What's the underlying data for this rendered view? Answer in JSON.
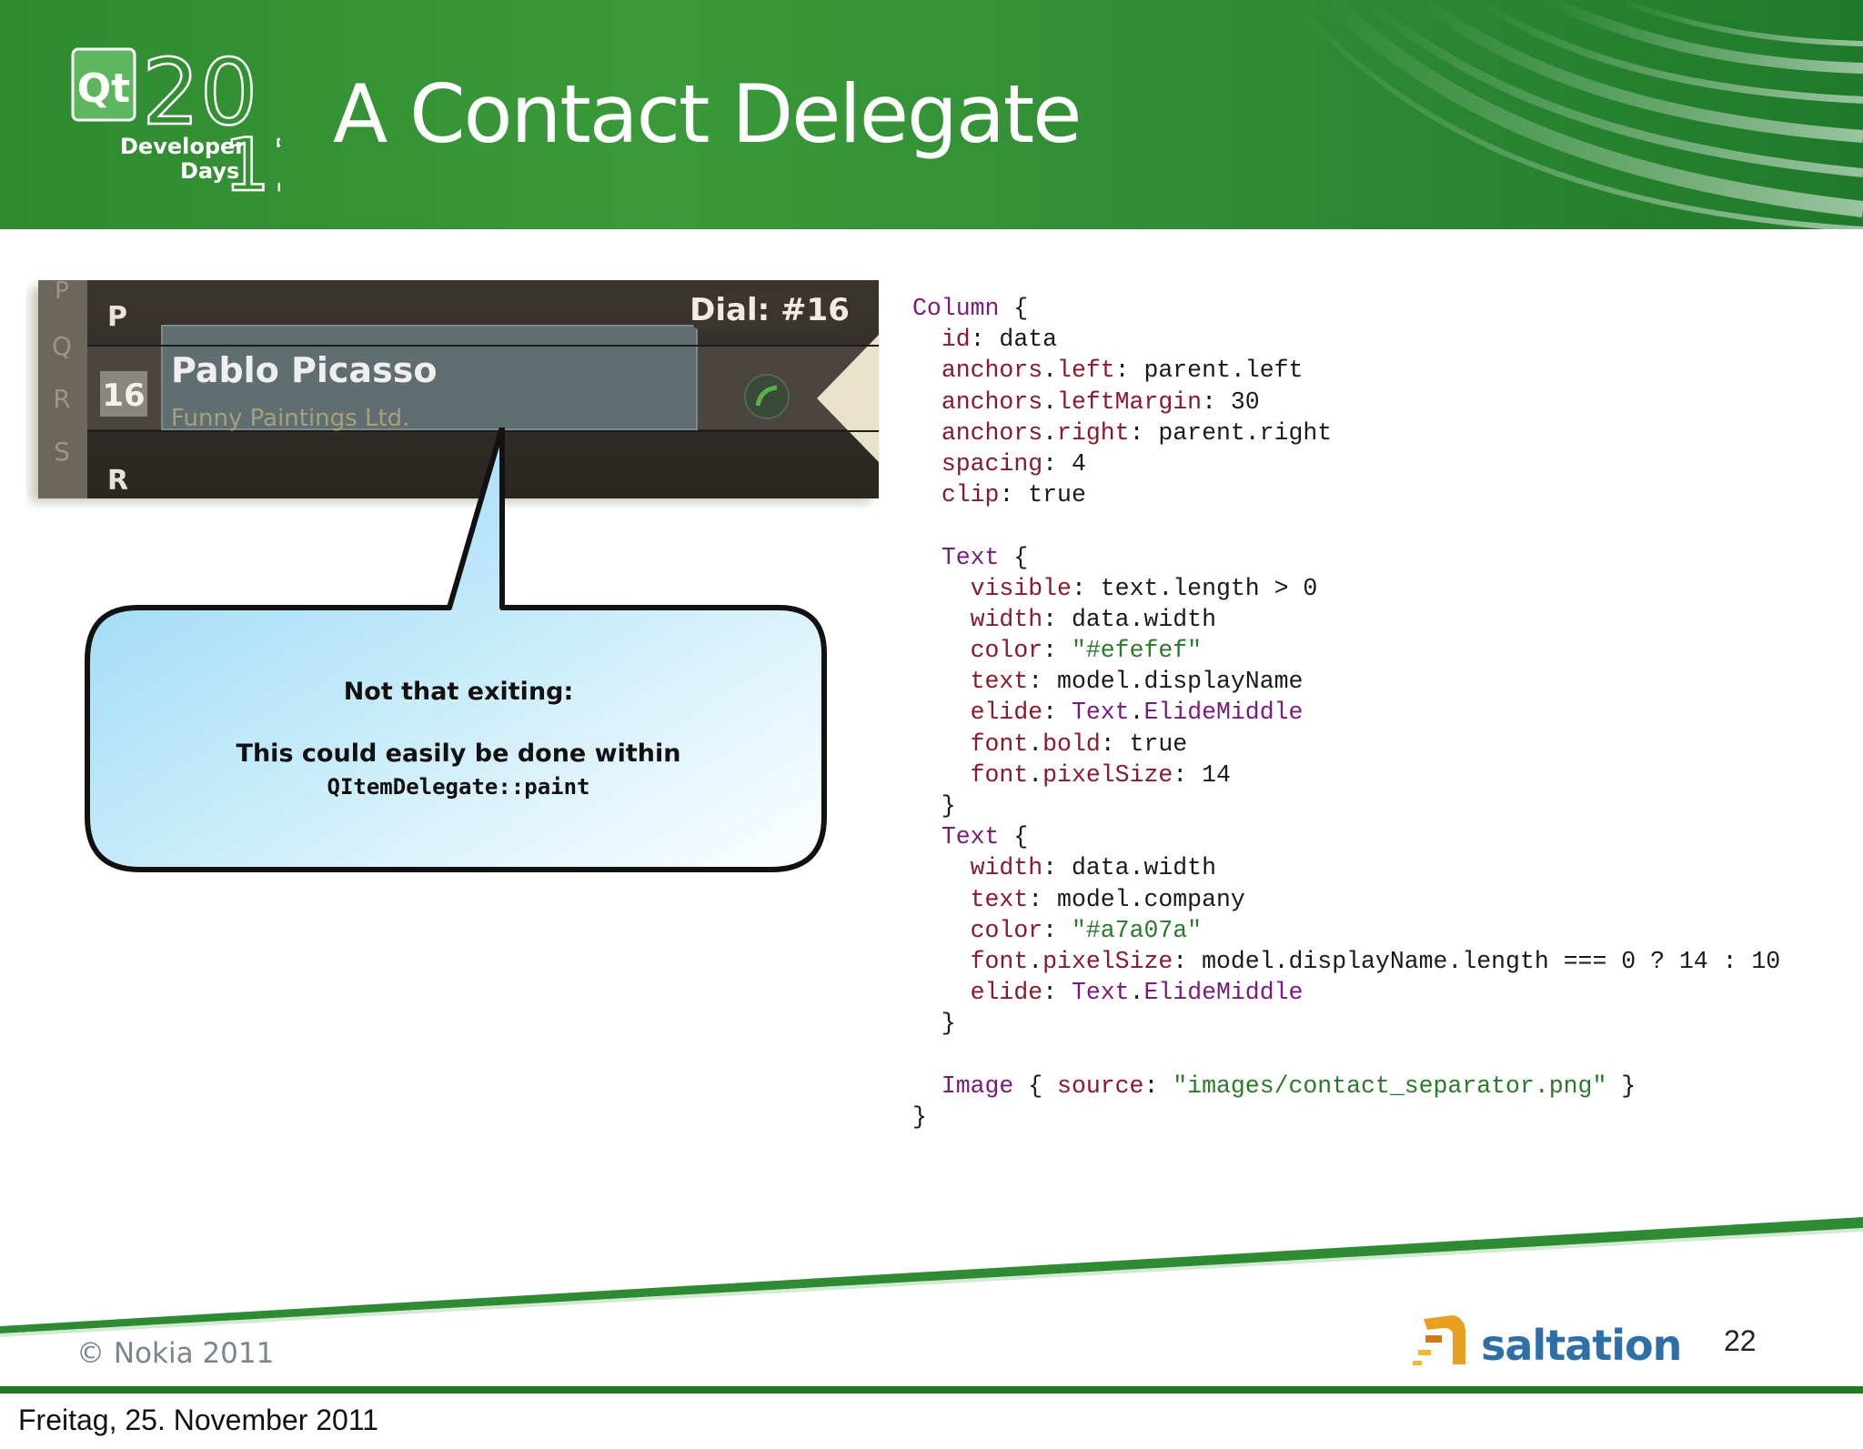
{
  "slide": {
    "title": "A Contact Delegate",
    "page_number": "22",
    "copyright": "© Nokia 2011",
    "brand": "saltation",
    "logo": {
      "qt": "Qt",
      "year_top": "20",
      "year_bottom": "11",
      "line1": "Developer",
      "line2": "Days"
    }
  },
  "screenshot": {
    "index_letters": [
      "P",
      "Q",
      "R",
      "S"
    ],
    "section_top": "P",
    "section_bottom": "R",
    "badge": "16",
    "dial_label": "Dial: #16",
    "contact_name": "Pablo Picasso",
    "contact_company": "Funny Paintings Ltd."
  },
  "callout": {
    "line1": "Not that exiting:",
    "line2": "This could easily be done within",
    "line3": "QItemDelegate::paint"
  },
  "code_lines": [
    [
      {
        "t": "Column",
        "c": "kw"
      },
      {
        "t": " {",
        "c": ""
      }
    ],
    [
      {
        "t": "  ",
        "c": ""
      },
      {
        "t": "id",
        "c": "pr"
      },
      {
        "t": ": data",
        "c": ""
      }
    ],
    [
      {
        "t": "  ",
        "c": ""
      },
      {
        "t": "anchors",
        "c": "pr"
      },
      {
        "t": ".",
        "c": ""
      },
      {
        "t": "left",
        "c": "pr"
      },
      {
        "t": ": parent.left",
        "c": ""
      }
    ],
    [
      {
        "t": "  ",
        "c": ""
      },
      {
        "t": "anchors",
        "c": "pr"
      },
      {
        "t": ".",
        "c": ""
      },
      {
        "t": "leftMargin",
        "c": "pr"
      },
      {
        "t": ": 30",
        "c": ""
      }
    ],
    [
      {
        "t": "  ",
        "c": ""
      },
      {
        "t": "anchors",
        "c": "pr"
      },
      {
        "t": ".",
        "c": ""
      },
      {
        "t": "right",
        "c": "pr"
      },
      {
        "t": ": parent.right",
        "c": ""
      }
    ],
    [
      {
        "t": "  ",
        "c": ""
      },
      {
        "t": "spacing",
        "c": "pr"
      },
      {
        "t": ": 4",
        "c": ""
      }
    ],
    [
      {
        "t": "  ",
        "c": ""
      },
      {
        "t": "clip",
        "c": "pr"
      },
      {
        "t": ": true",
        "c": ""
      }
    ],
    [
      {
        "t": "",
        "c": ""
      }
    ],
    [
      {
        "t": "  ",
        "c": ""
      },
      {
        "t": "Text",
        "c": "kw"
      },
      {
        "t": " {",
        "c": ""
      }
    ],
    [
      {
        "t": "    ",
        "c": ""
      },
      {
        "t": "visible",
        "c": "pr"
      },
      {
        "t": ": text.length > 0",
        "c": ""
      }
    ],
    [
      {
        "t": "    ",
        "c": ""
      },
      {
        "t": "width",
        "c": "pr"
      },
      {
        "t": ": data.width",
        "c": ""
      }
    ],
    [
      {
        "t": "    ",
        "c": ""
      },
      {
        "t": "color",
        "c": "pr"
      },
      {
        "t": ": ",
        "c": ""
      },
      {
        "t": "\"#efefef\"",
        "c": "st"
      }
    ],
    [
      {
        "t": "    ",
        "c": ""
      },
      {
        "t": "text",
        "c": "pr"
      },
      {
        "t": ": model.displayName",
        "c": ""
      }
    ],
    [
      {
        "t": "    ",
        "c": ""
      },
      {
        "t": "elide",
        "c": "pr"
      },
      {
        "t": ": ",
        "c": ""
      },
      {
        "t": "Text",
        "c": "cl"
      },
      {
        "t": ".",
        "c": ""
      },
      {
        "t": "ElideMiddle",
        "c": "cl"
      }
    ],
    [
      {
        "t": "    ",
        "c": ""
      },
      {
        "t": "font",
        "c": "pr"
      },
      {
        "t": ".",
        "c": ""
      },
      {
        "t": "bold",
        "c": "pr"
      },
      {
        "t": ": true",
        "c": ""
      }
    ],
    [
      {
        "t": "    ",
        "c": ""
      },
      {
        "t": "font",
        "c": "pr"
      },
      {
        "t": ".",
        "c": ""
      },
      {
        "t": "pixelSize",
        "c": "pr"
      },
      {
        "t": ": 14",
        "c": ""
      }
    ],
    [
      {
        "t": "  }",
        "c": ""
      }
    ],
    [
      {
        "t": "  ",
        "c": ""
      },
      {
        "t": "Text",
        "c": "kw"
      },
      {
        "t": " {",
        "c": ""
      }
    ],
    [
      {
        "t": "    ",
        "c": ""
      },
      {
        "t": "width",
        "c": "pr"
      },
      {
        "t": ": data.width",
        "c": ""
      }
    ],
    [
      {
        "t": "    ",
        "c": ""
      },
      {
        "t": "text",
        "c": "pr"
      },
      {
        "t": ": model.company",
        "c": ""
      }
    ],
    [
      {
        "t": "    ",
        "c": ""
      },
      {
        "t": "color",
        "c": "pr"
      },
      {
        "t": ": ",
        "c": ""
      },
      {
        "t": "\"#a7a07a\"",
        "c": "st"
      }
    ],
    [
      {
        "t": "    ",
        "c": ""
      },
      {
        "t": "font",
        "c": "pr"
      },
      {
        "t": ".",
        "c": ""
      },
      {
        "t": "pixelSize",
        "c": "pr"
      },
      {
        "t": ": model.displayName.length === 0 ? 14 : 10",
        "c": ""
      }
    ],
    [
      {
        "t": "    ",
        "c": ""
      },
      {
        "t": "elide",
        "c": "pr"
      },
      {
        "t": ": ",
        "c": ""
      },
      {
        "t": "Text",
        "c": "cl"
      },
      {
        "t": ".",
        "c": ""
      },
      {
        "t": "ElideMiddle",
        "c": "cl"
      }
    ],
    [
      {
        "t": "  }",
        "c": ""
      }
    ],
    [
      {
        "t": "",
        "c": ""
      }
    ],
    [
      {
        "t": "  ",
        "c": ""
      },
      {
        "t": "Image",
        "c": "kw"
      },
      {
        "t": " { ",
        "c": ""
      },
      {
        "t": "source",
        "c": "pr"
      },
      {
        "t": ": ",
        "c": ""
      },
      {
        "t": "\"images/contact_separator.png\"",
        "c": "st"
      },
      {
        "t": " }",
        "c": ""
      }
    ],
    [
      {
        "t": "}",
        "c": ""
      }
    ]
  ],
  "footer": {
    "date": "Freitag, 25. November 2011"
  },
  "colors": {
    "header_green": "#2f8a2f",
    "footer_green": "#1f7a2a",
    "callout_fill": "#a8dcf5",
    "code_keyword": "#7a1a7a",
    "code_property": "#8a1a2a",
    "code_string": "#2a7a2a"
  }
}
